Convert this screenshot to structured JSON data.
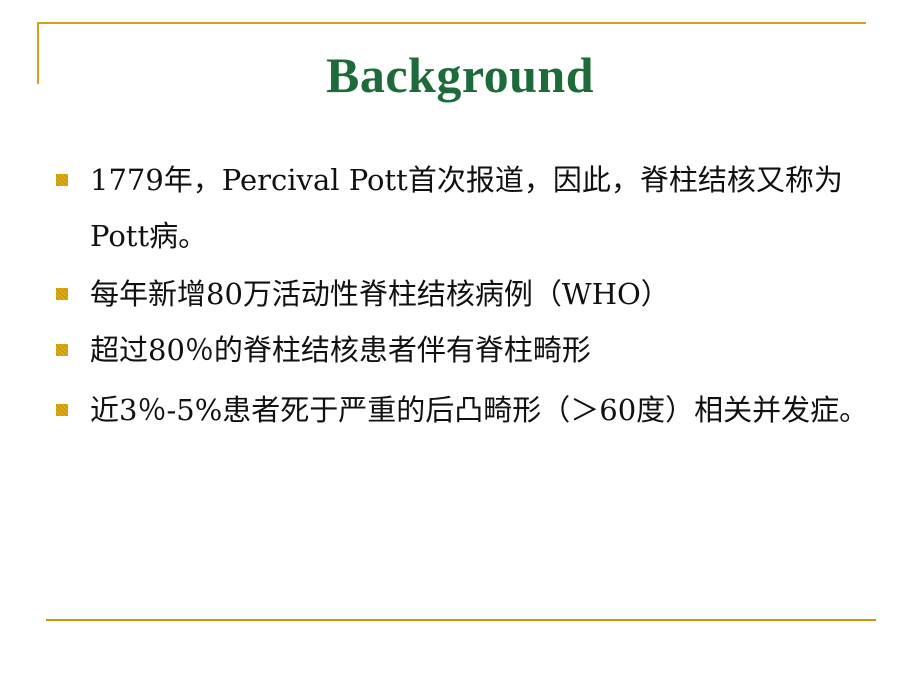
{
  "slide": {
    "title": "Background",
    "accent_color": "#d4a017",
    "title_color": "#1e6b3a",
    "bullets": [
      {
        "icon": "square-bullet-icon",
        "text": "1779年，Percival Pott首次报道，因此，脊柱结核又称为Pott病。"
      },
      {
        "icon": "square-bullet-icon",
        "text": "每年新增80万活动性脊柱结核病例（WHO）"
      },
      {
        "icon": "square-bullet-icon",
        "text": "超过80％的脊柱结核患者伴有脊柱畸形"
      },
      {
        "icon": "square-bullet-icon",
        "text": "近3％-5%患者死于严重的后凸畸形（＞60度）相关并发症。"
      }
    ]
  }
}
